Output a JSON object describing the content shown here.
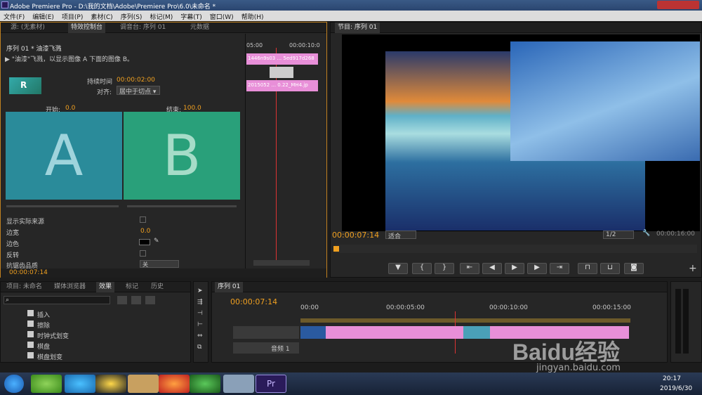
{
  "app": {
    "title": "Adobe Premiere Pro - D:\\我的文档\\Adobe\\Premiere Pro\\6.0\\未命名 *"
  },
  "menu": [
    "文件(F)",
    "编辑(E)",
    "项目(P)",
    "素材(C)",
    "序列(S)",
    "标记(M)",
    "字幕(T)",
    "窗口(W)",
    "帮助(H)"
  ],
  "source_tabs": {
    "source": "源: (无素材)",
    "effect_controls": "特效控制台",
    "audio_mixer": "调音台: 序列 01",
    "metadata": "元数据"
  },
  "effect": {
    "sequence": "序列 01 * 油漆飞溅",
    "description": "\"油漆\"飞溅，以显示图像 A 下面的图像 B。",
    "duration_label": "持续时间",
    "duration_value": "00:00:02:00",
    "align_label": "对齐:",
    "align_value": "居中于切点",
    "start_label": "开始:",
    "start_value": "0.0",
    "end_label": "结束:",
    "end_value": "100.0",
    "a": "A",
    "b": "B",
    "props": [
      {
        "label": "显示实际来源"
      },
      {
        "label": "边宽",
        "value": "0.0"
      },
      {
        "label": "边色"
      },
      {
        "label": "反转"
      },
      {
        "label": "抗锯齿品质",
        "value": "关"
      }
    ],
    "timecode": "00:00:07:14",
    "mini_timeline": {
      "t0": "05:00",
      "t1": "00:00:10:0",
      "clip1": "1446n9s03 ... 5ed917d268",
      "clip2": "2015052 ... 0.22_MH4.jp"
    }
  },
  "program": {
    "tab": "节目: 序列 01",
    "timecode": "00:00:07:14",
    "fit": "适合",
    "resolution": "1/2",
    "duration": "00:00:16:00"
  },
  "project": {
    "tabs": [
      "项目: 未命名",
      "媒体浏览器",
      "效果",
      "标记",
      "历史"
    ],
    "items": [
      "插入",
      "擦除",
      "时钟式划变",
      "棋盘",
      "棋盘划变"
    ]
  },
  "timeline": {
    "tab": "序列 01",
    "timecode": "00:00:07:14",
    "ticks": [
      "00:00",
      "00:00:05:00",
      "00:00:10:00",
      "00:00:15:00"
    ],
    "audio_track": "音频 1"
  },
  "taskbar": {
    "time": "20:17",
    "date": "2019/6/30"
  },
  "watermark": {
    "brand": "Baidu经验",
    "url": "jingyan.baidu.com"
  },
  "colors": {
    "accent": "#f0a020",
    "clip_pink": "#e88fd8",
    "transition_a": "#2a8b9a",
    "transition_b": "#29a07a"
  }
}
